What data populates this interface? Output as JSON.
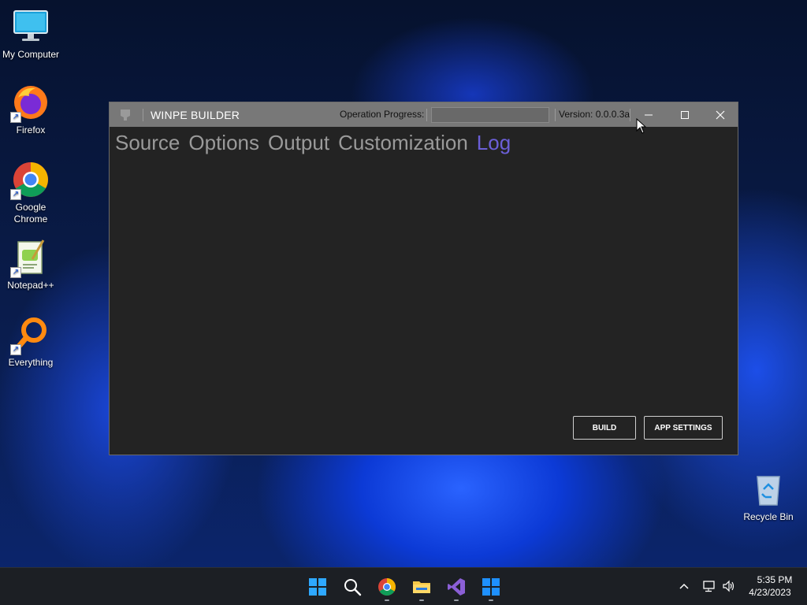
{
  "desktop": {
    "icons": [
      {
        "label": "My Computer"
      },
      {
        "label": "Firefox"
      },
      {
        "label": "Google Chrome"
      },
      {
        "label": "Notepad++"
      },
      {
        "label": "Everything"
      },
      {
        "label": "Recycle Bin"
      }
    ]
  },
  "window": {
    "title": "WINPE BUILDER",
    "operation_progress_label": "Operation Progress:",
    "operation_progress_value": 0,
    "version": "Version: 0.0.0.3a",
    "tabs": [
      {
        "label": "Source",
        "active": false
      },
      {
        "label": "Options",
        "active": false
      },
      {
        "label": "Output",
        "active": false
      },
      {
        "label": "Customization",
        "active": false
      },
      {
        "label": "Log",
        "active": true
      }
    ],
    "buttons": {
      "build": "BUILD",
      "app_settings": "APP SETTINGS"
    }
  },
  "taskbar": {
    "apps": [
      "start-icon",
      "search-icon",
      "chrome-icon",
      "file-explorer-icon",
      "visual-studio-icon",
      "winpe-builder-icon"
    ],
    "clock_time": "5:35 PM",
    "clock_date": "4/23/2023"
  },
  "colors": {
    "accent_tab": "#6b5fd8",
    "titlebar": "#787878",
    "window_bg": "#232323"
  }
}
